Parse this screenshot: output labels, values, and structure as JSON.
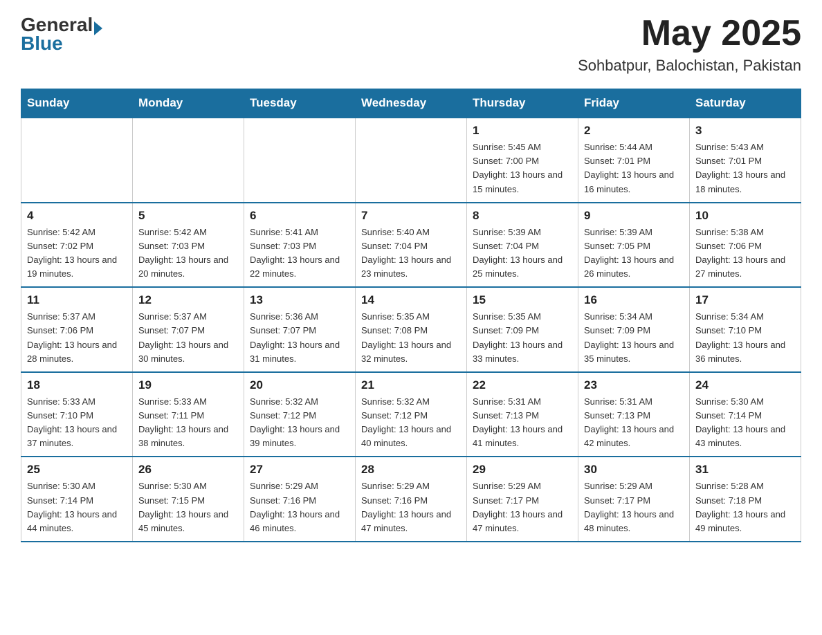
{
  "header": {
    "logo_general": "General",
    "logo_blue": "Blue",
    "month_year": "May 2025",
    "location": "Sohbatpur, Balochistan, Pakistan"
  },
  "days_of_week": [
    "Sunday",
    "Monday",
    "Tuesday",
    "Wednesday",
    "Thursday",
    "Friday",
    "Saturday"
  ],
  "weeks": [
    [
      {
        "day": "",
        "info": ""
      },
      {
        "day": "",
        "info": ""
      },
      {
        "day": "",
        "info": ""
      },
      {
        "day": "",
        "info": ""
      },
      {
        "day": "1",
        "info": "Sunrise: 5:45 AM\nSunset: 7:00 PM\nDaylight: 13 hours and 15 minutes."
      },
      {
        "day": "2",
        "info": "Sunrise: 5:44 AM\nSunset: 7:01 PM\nDaylight: 13 hours and 16 minutes."
      },
      {
        "day": "3",
        "info": "Sunrise: 5:43 AM\nSunset: 7:01 PM\nDaylight: 13 hours and 18 minutes."
      }
    ],
    [
      {
        "day": "4",
        "info": "Sunrise: 5:42 AM\nSunset: 7:02 PM\nDaylight: 13 hours and 19 minutes."
      },
      {
        "day": "5",
        "info": "Sunrise: 5:42 AM\nSunset: 7:03 PM\nDaylight: 13 hours and 20 minutes."
      },
      {
        "day": "6",
        "info": "Sunrise: 5:41 AM\nSunset: 7:03 PM\nDaylight: 13 hours and 22 minutes."
      },
      {
        "day": "7",
        "info": "Sunrise: 5:40 AM\nSunset: 7:04 PM\nDaylight: 13 hours and 23 minutes."
      },
      {
        "day": "8",
        "info": "Sunrise: 5:39 AM\nSunset: 7:04 PM\nDaylight: 13 hours and 25 minutes."
      },
      {
        "day": "9",
        "info": "Sunrise: 5:39 AM\nSunset: 7:05 PM\nDaylight: 13 hours and 26 minutes."
      },
      {
        "day": "10",
        "info": "Sunrise: 5:38 AM\nSunset: 7:06 PM\nDaylight: 13 hours and 27 minutes."
      }
    ],
    [
      {
        "day": "11",
        "info": "Sunrise: 5:37 AM\nSunset: 7:06 PM\nDaylight: 13 hours and 28 minutes."
      },
      {
        "day": "12",
        "info": "Sunrise: 5:37 AM\nSunset: 7:07 PM\nDaylight: 13 hours and 30 minutes."
      },
      {
        "day": "13",
        "info": "Sunrise: 5:36 AM\nSunset: 7:07 PM\nDaylight: 13 hours and 31 minutes."
      },
      {
        "day": "14",
        "info": "Sunrise: 5:35 AM\nSunset: 7:08 PM\nDaylight: 13 hours and 32 minutes."
      },
      {
        "day": "15",
        "info": "Sunrise: 5:35 AM\nSunset: 7:09 PM\nDaylight: 13 hours and 33 minutes."
      },
      {
        "day": "16",
        "info": "Sunrise: 5:34 AM\nSunset: 7:09 PM\nDaylight: 13 hours and 35 minutes."
      },
      {
        "day": "17",
        "info": "Sunrise: 5:34 AM\nSunset: 7:10 PM\nDaylight: 13 hours and 36 minutes."
      }
    ],
    [
      {
        "day": "18",
        "info": "Sunrise: 5:33 AM\nSunset: 7:10 PM\nDaylight: 13 hours and 37 minutes."
      },
      {
        "day": "19",
        "info": "Sunrise: 5:33 AM\nSunset: 7:11 PM\nDaylight: 13 hours and 38 minutes."
      },
      {
        "day": "20",
        "info": "Sunrise: 5:32 AM\nSunset: 7:12 PM\nDaylight: 13 hours and 39 minutes."
      },
      {
        "day": "21",
        "info": "Sunrise: 5:32 AM\nSunset: 7:12 PM\nDaylight: 13 hours and 40 minutes."
      },
      {
        "day": "22",
        "info": "Sunrise: 5:31 AM\nSunset: 7:13 PM\nDaylight: 13 hours and 41 minutes."
      },
      {
        "day": "23",
        "info": "Sunrise: 5:31 AM\nSunset: 7:13 PM\nDaylight: 13 hours and 42 minutes."
      },
      {
        "day": "24",
        "info": "Sunrise: 5:30 AM\nSunset: 7:14 PM\nDaylight: 13 hours and 43 minutes."
      }
    ],
    [
      {
        "day": "25",
        "info": "Sunrise: 5:30 AM\nSunset: 7:14 PM\nDaylight: 13 hours and 44 minutes."
      },
      {
        "day": "26",
        "info": "Sunrise: 5:30 AM\nSunset: 7:15 PM\nDaylight: 13 hours and 45 minutes."
      },
      {
        "day": "27",
        "info": "Sunrise: 5:29 AM\nSunset: 7:16 PM\nDaylight: 13 hours and 46 minutes."
      },
      {
        "day": "28",
        "info": "Sunrise: 5:29 AM\nSunset: 7:16 PM\nDaylight: 13 hours and 47 minutes."
      },
      {
        "day": "29",
        "info": "Sunrise: 5:29 AM\nSunset: 7:17 PM\nDaylight: 13 hours and 47 minutes."
      },
      {
        "day": "30",
        "info": "Sunrise: 5:29 AM\nSunset: 7:17 PM\nDaylight: 13 hours and 48 minutes."
      },
      {
        "day": "31",
        "info": "Sunrise: 5:28 AM\nSunset: 7:18 PM\nDaylight: 13 hours and 49 minutes."
      }
    ]
  ]
}
